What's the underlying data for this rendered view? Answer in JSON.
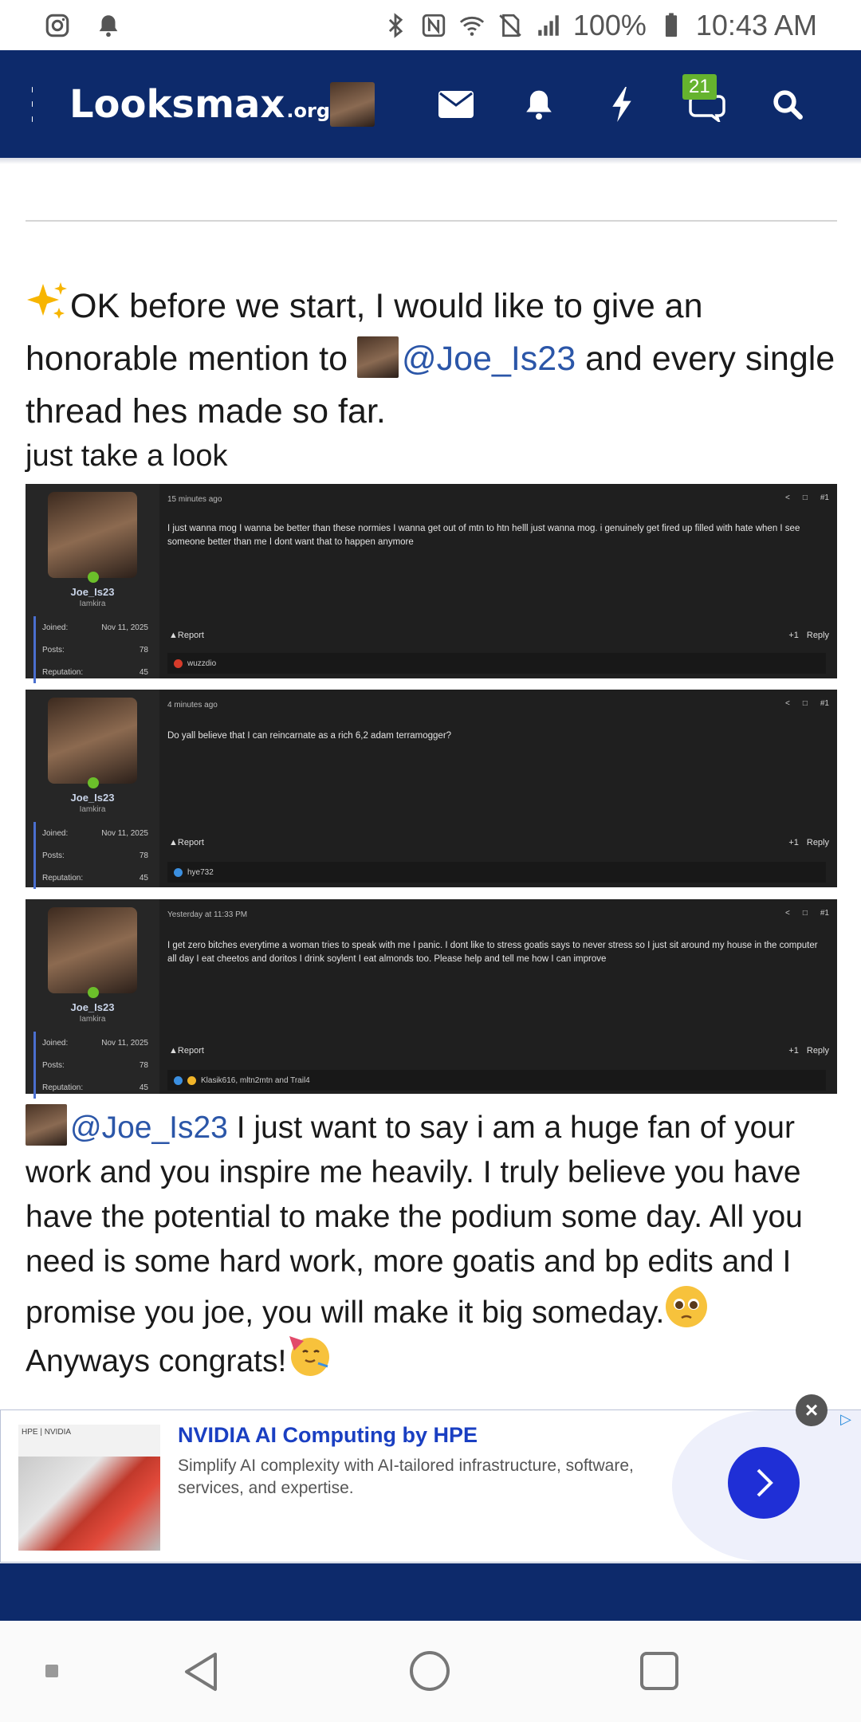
{
  "status_bar": {
    "battery": "100%",
    "time": "10:43 AM"
  },
  "header": {
    "logo_main": "Looksmax",
    "logo_domain": ".org",
    "conversations_badge": "21"
  },
  "post": {
    "intro_emoji": "sparkles-emoji",
    "intro_line": "OK before we start, I would like to give an honorable mention to ",
    "mention": "@Joe_Is23",
    "intro_tail": " and every single thread hes made so far.",
    "subline": "just take a look",
    "closing_mention": "@Joe_Is23",
    "closing_text": " I just want to say i am a huge fan of your work and you inspire me heavily. I truly believe you have have the potential to make the podium some day. All you need is some hard work, more goatis and bp edits and I promise you joe, you will make it big someday.",
    "closing_line2": "Anyways congrats!"
  },
  "screenshots": [
    {
      "username": "Joe_Is23",
      "user_title": "Iamkira",
      "joined_label": "Joined:",
      "joined": "Nov 11, 2025",
      "posts_label": "Posts:",
      "posts": "78",
      "rep_label": "Reputation:",
      "reputation": "45",
      "time": "15 minutes ago",
      "post_num": "#1",
      "body": "I just wanna mog I wanna be better than these normies I wanna get out of mtn to htn helll just wanna mog. i genuinely get fired up filled with hate when I see someone better than me I dont want that to happen anymore",
      "report": "Report",
      "like": "+1",
      "reply": "Reply",
      "reactions": "wuzzdio"
    },
    {
      "username": "Joe_Is23",
      "user_title": "Iamkira",
      "joined_label": "Joined:",
      "joined": "Nov 11, 2025",
      "posts_label": "Posts:",
      "posts": "78",
      "rep_label": "Reputation:",
      "reputation": "45",
      "time": "4 minutes ago",
      "post_num": "#1",
      "body": "Do yall believe that I can reincarnate as a rich 6,2 adam terramogger?",
      "report": "Report",
      "like": "+1",
      "reply": "Reply",
      "reactions": "hye732"
    },
    {
      "username": "Joe_Is23",
      "user_title": "Iamkira",
      "joined_label": "Joined:",
      "joined": "Nov 11, 2025",
      "posts_label": "Posts:",
      "posts": "78",
      "rep_label": "Reputation:",
      "reputation": "45",
      "time": "Yesterday at 11:33 PM",
      "post_num": "#1",
      "body": "I get zero bitches everytime a woman tries to speak with me I panic. I dont like to stress goatis says to never stress so I just sit around my house in the computer all day I eat cheetos and doritos I drink soylent I eat almonds too. Please help and tell me how I can improve",
      "report": "Report",
      "like": "+1",
      "reply": "Reply",
      "reactions": "Klasik616, mltn2mtn and Trail4"
    }
  ],
  "ad": {
    "title": "NVIDIA AI Computing by HPE",
    "description": "Simplify AI complexity with AI-tailored infrastructure, software, services, and expertise.",
    "brand_logos": "HPE | NVIDIA"
  },
  "colors": {
    "header_bg": "#0d2a6b",
    "mention": "#2b56a8",
    "badge": "#65b32e",
    "ad_title": "#1a3fc2",
    "ad_button": "#1f2fd6"
  }
}
